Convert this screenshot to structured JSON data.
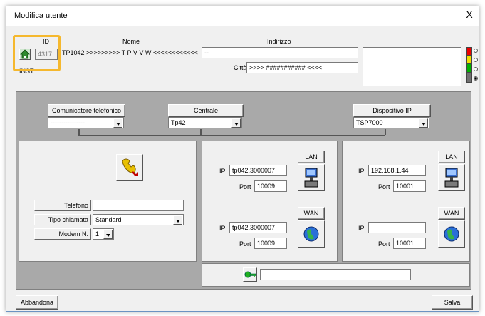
{
  "window": {
    "title": "Modifica utente",
    "close_label": "X"
  },
  "header": {
    "id_label": "ID",
    "id_value": "4317",
    "inst_label": "INST",
    "inst_value": "",
    "nome_label": "Nome",
    "nome_value": "TP1042 >>>>>>>>> T P V V W <<<<<<<<<<<<",
    "indirizzo_label": "Indirizzo",
    "indirizzo_value": "--",
    "citta_label": "Città",
    "citta_value": ">>>> ########### <<<<"
  },
  "status_lights": {
    "colors": [
      "#ee0000",
      "#f0e000",
      "#00b000",
      "#707070"
    ],
    "selected_index": 3
  },
  "comunicatore": {
    "label": "Comunicatore telefonico",
    "value": "----------------"
  },
  "centrale": {
    "label": "Centrale",
    "value": "Tp42"
  },
  "dispositivo": {
    "label": "Dispositivo IP",
    "value": "TSP7000"
  },
  "phone_panel": {
    "icon": "telephone-icon",
    "telefono_label": "Telefono",
    "telefono_value": "",
    "tipo_chiamata_label": "Tipo chiamata",
    "tipo_chiamata_value": "Standard",
    "modem_label": "Modem N.",
    "modem_value": "1"
  },
  "centrale_panel": {
    "lan": {
      "label": "LAN",
      "ip_label": "IP",
      "ip_value": "tp042.3000007",
      "port_label": "Port",
      "port_value": "10009"
    },
    "wan": {
      "label": "WAN",
      "ip_label": "IP",
      "ip_value": "tp042.3000007",
      "port_label": "Port",
      "port_value": "10009"
    }
  },
  "dispositivo_panel": {
    "lan": {
      "label": "LAN",
      "ip_label": "IP",
      "ip_value": "192.168.1.44",
      "port_label": "Port",
      "port_value": "10001"
    },
    "wan": {
      "label": "WAN",
      "ip_label": "IP",
      "ip_value": "",
      "port_label": "Port",
      "port_value": "10001"
    }
  },
  "key_field": {
    "icon": "key-icon",
    "value": ""
  },
  "footer": {
    "abbandona_label": "Abbandona",
    "salva_label": "Salva"
  },
  "highlight_color": "#f5b82e"
}
